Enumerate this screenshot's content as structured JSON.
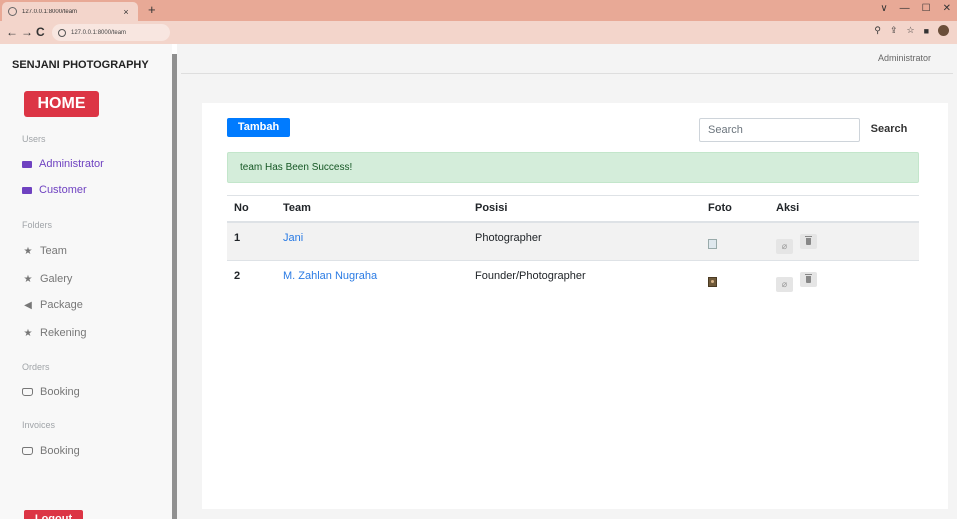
{
  "browser": {
    "tab_title": "127.0.0.1:8000/team",
    "tab_close": "×",
    "new_tab": "+",
    "url": "127.0.0.1:8000/team",
    "window_controls": [
      "∨",
      "—",
      "☐",
      "✕"
    ]
  },
  "sidebar": {
    "brand": "SENJANI PHOTOGRAPHY",
    "home_label": "HOME",
    "sections": {
      "users": "Users",
      "folders": "Folders",
      "orders": "Orders",
      "invoices": "Invoices"
    },
    "items": {
      "administrator": "Administrator",
      "customer": "Customer",
      "team": "Team",
      "galery": "Galery",
      "package": "Package",
      "rekening": "Rekening",
      "orders_booking": "Booking",
      "invoices_booking": "Booking"
    },
    "logout_label": "Logout"
  },
  "header": {
    "user_label": "Administrator"
  },
  "toolbar": {
    "add_label": "Tambah",
    "search_placeholder": "Search",
    "search_label": "Search"
  },
  "alert": {
    "text": "team Has Been Success!"
  },
  "table": {
    "headers": {
      "no": "No",
      "team": "Team",
      "posisi": "Posisi",
      "foto": "Foto",
      "aksi": "Aksi"
    },
    "rows": [
      {
        "no": "1",
        "team": "Jani",
        "posisi": "Photographer"
      },
      {
        "no": "2",
        "team": "M. Zahlan Nugraha",
        "posisi": "Founder/Photographer"
      }
    ]
  },
  "colors": {
    "accent_blue": "#007bff",
    "danger_red": "#dc3545",
    "success_bg": "#d4edda",
    "link_blue": "#2a7be4",
    "sidebar_purple": "#6f42c1"
  }
}
